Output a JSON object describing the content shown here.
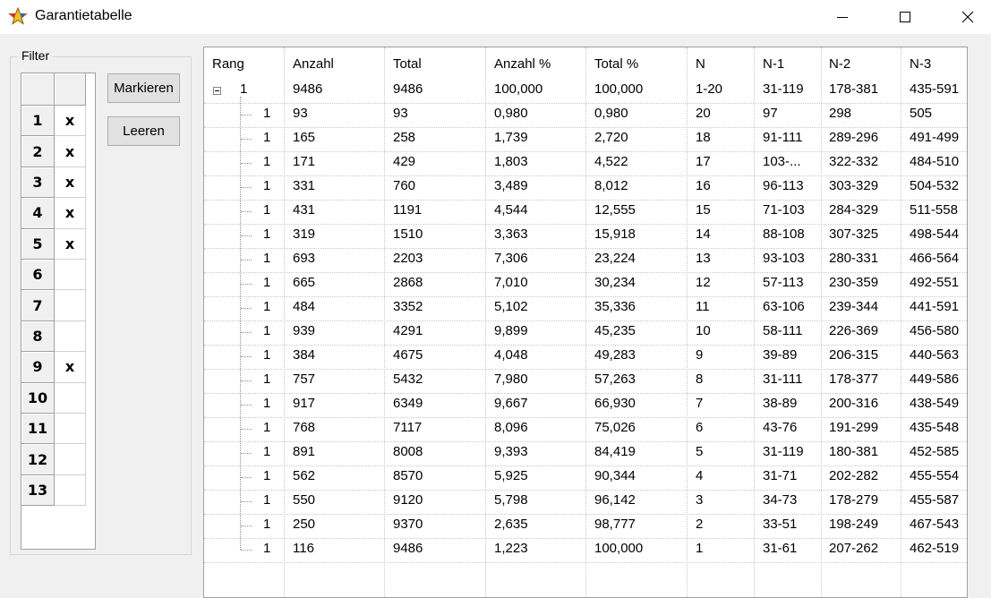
{
  "window": {
    "title": "Garantietabelle"
  },
  "filter": {
    "legend": "Filter",
    "rows": [
      {
        "num": "1",
        "mark": "x"
      },
      {
        "num": "2",
        "mark": "x"
      },
      {
        "num": "3",
        "mark": "x"
      },
      {
        "num": "4",
        "mark": "x"
      },
      {
        "num": "5",
        "mark": "x"
      },
      {
        "num": "6",
        "mark": ""
      },
      {
        "num": "7",
        "mark": ""
      },
      {
        "num": "8",
        "mark": ""
      },
      {
        "num": "9",
        "mark": "x"
      },
      {
        "num": "10",
        "mark": ""
      },
      {
        "num": "11",
        "mark": ""
      },
      {
        "num": "12",
        "mark": ""
      },
      {
        "num": "13",
        "mark": ""
      }
    ]
  },
  "buttons": {
    "mark": "Markieren",
    "clear": "Leeren"
  },
  "table": {
    "columns": [
      "Rang",
      "Anzahl",
      "Total",
      "Anzahl %",
      "Total %",
      "N",
      "N-1",
      "N-2",
      "N-3"
    ],
    "root": [
      "1",
      "9486",
      "9486",
      "100,000",
      "100,000",
      "1-20",
      "31-119",
      "178-381",
      "435-591"
    ],
    "rows": [
      [
        "1",
        "93",
        "93",
        "0,980",
        "0,980",
        "20",
        "97",
        "298",
        "505"
      ],
      [
        "1",
        "165",
        "258",
        "1,739",
        "2,720",
        "18",
        "91-111",
        "289-296",
        "491-499"
      ],
      [
        "1",
        "171",
        "429",
        "1,803",
        "4,522",
        "17",
        "103-...",
        "322-332",
        "484-510"
      ],
      [
        "1",
        "331",
        "760",
        "3,489",
        "8,012",
        "16",
        "96-113",
        "303-329",
        "504-532"
      ],
      [
        "1",
        "431",
        "1191",
        "4,544",
        "12,555",
        "15",
        "71-103",
        "284-329",
        "511-558"
      ],
      [
        "1",
        "319",
        "1510",
        "3,363",
        "15,918",
        "14",
        "88-108",
        "307-325",
        "498-544"
      ],
      [
        "1",
        "693",
        "2203",
        "7,306",
        "23,224",
        "13",
        "93-103",
        "280-331",
        "466-564"
      ],
      [
        "1",
        "665",
        "2868",
        "7,010",
        "30,234",
        "12",
        "57-113",
        "230-359",
        "492-551"
      ],
      [
        "1",
        "484",
        "3352",
        "5,102",
        "35,336",
        "11",
        "63-106",
        "239-344",
        "441-591"
      ],
      [
        "1",
        "939",
        "4291",
        "9,899",
        "45,235",
        "10",
        "58-111",
        "226-369",
        "456-580"
      ],
      [
        "1",
        "384",
        "4675",
        "4,048",
        "49,283",
        "9",
        "39-89",
        "206-315",
        "440-563"
      ],
      [
        "1",
        "757",
        "5432",
        "7,980",
        "57,263",
        "8",
        "31-111",
        "178-377",
        "449-586"
      ],
      [
        "1",
        "917",
        "6349",
        "9,667",
        "66,930",
        "7",
        "38-89",
        "200-316",
        "438-549"
      ],
      [
        "1",
        "768",
        "7117",
        "8,096",
        "75,026",
        "6",
        "43-76",
        "191-299",
        "435-548"
      ],
      [
        "1",
        "891",
        "8008",
        "9,393",
        "84,419",
        "5",
        "31-119",
        "180-381",
        "452-585"
      ],
      [
        "1",
        "562",
        "8570",
        "5,925",
        "90,344",
        "4",
        "31-71",
        "202-282",
        "455-554"
      ],
      [
        "1",
        "550",
        "9120",
        "5,798",
        "96,142",
        "3",
        "34-73",
        "178-279",
        "455-587"
      ],
      [
        "1",
        "250",
        "9370",
        "2,635",
        "98,777",
        "2",
        "33-51",
        "198-249",
        "467-543"
      ],
      [
        "1",
        "116",
        "9486",
        "1,223",
        "100,000",
        "1",
        "31-61",
        "207-262",
        "462-519"
      ]
    ]
  }
}
